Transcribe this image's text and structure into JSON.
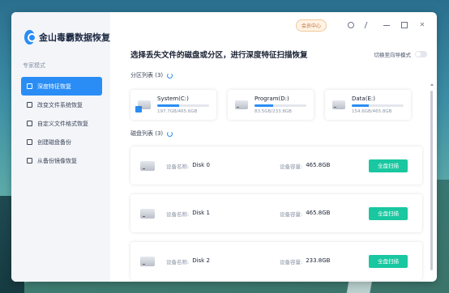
{
  "app": {
    "title": "金山毒霸数据恢复",
    "member_label": "会员中心"
  },
  "sidebar": {
    "mode_label": "专家模式",
    "items": [
      {
        "label": "深度特征恢复",
        "active": true
      },
      {
        "label": "改变文件系统恢复",
        "active": false
      },
      {
        "label": "自定义文件格式恢复",
        "active": false
      },
      {
        "label": "创建磁盘备份",
        "active": false
      },
      {
        "label": "从备份镜像恢复",
        "active": false
      }
    ]
  },
  "main": {
    "headline": "选择丢失文件的磁盘或分区，进行深度特征扫描恢复",
    "switch_label": "切换至向导模式",
    "partitions_label": "分区列表 (3)",
    "partitions": [
      {
        "name": "System(C:)",
        "size": "197.7GB/465.6GB",
        "usage": 0.42,
        "system": true
      },
      {
        "name": "Program(D:)",
        "size": "83.5GB/233.8GB",
        "usage": 0.36,
        "system": false
      },
      {
        "name": "Data(E:)",
        "size": "154.6GB/465.8GB",
        "usage": 0.33,
        "system": false
      }
    ],
    "disks_label": "磁盘列表 (3)",
    "disks": [
      {
        "name_key": "设备名称:",
        "name": "Disk 0",
        "cap_key": "设备容量:",
        "capacity": "465.8GB",
        "button": "全盘扫描"
      },
      {
        "name_key": "设备名称:",
        "name": "Disk 1",
        "cap_key": "设备容量:",
        "capacity": "465.8GB",
        "button": "全盘扫描"
      },
      {
        "name_key": "设备名称:",
        "name": "Disk 2",
        "cap_key": "设备容量:",
        "capacity": "233.8GB",
        "button": "全盘扫描"
      }
    ]
  },
  "colors": {
    "accent": "#2a8df5",
    "scan_button": "#19c7a0",
    "member": "#c0703a"
  }
}
